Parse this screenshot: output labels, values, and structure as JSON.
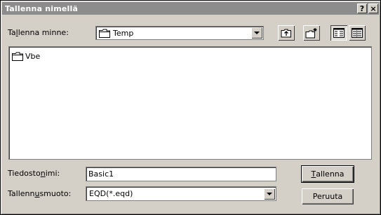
{
  "window": {
    "title": "Tallenna nimellä",
    "help": "?",
    "close": "×"
  },
  "save_in": {
    "label_pre": "Ta",
    "label_u": "l",
    "label_post": "lenna minne:",
    "value": "Temp"
  },
  "files": [
    {
      "name": "Vbe",
      "icon": "folder-icon"
    }
  ],
  "filename": {
    "label_pre": "Tiedosto",
    "label_u": "n",
    "label_post": "imi:",
    "value": "Basic1"
  },
  "filetype": {
    "label_pre": "Tallenn",
    "label_u": "u",
    "label_post": "smuoto:",
    "value": "EQD(*.eqd)"
  },
  "buttons": {
    "save_u": "T",
    "save_rest": "allenna",
    "cancel": "Peruuta"
  },
  "toolbar": [
    "up-one-level-icon",
    "new-folder-icon",
    "list-view-icon",
    "details-view-icon"
  ]
}
